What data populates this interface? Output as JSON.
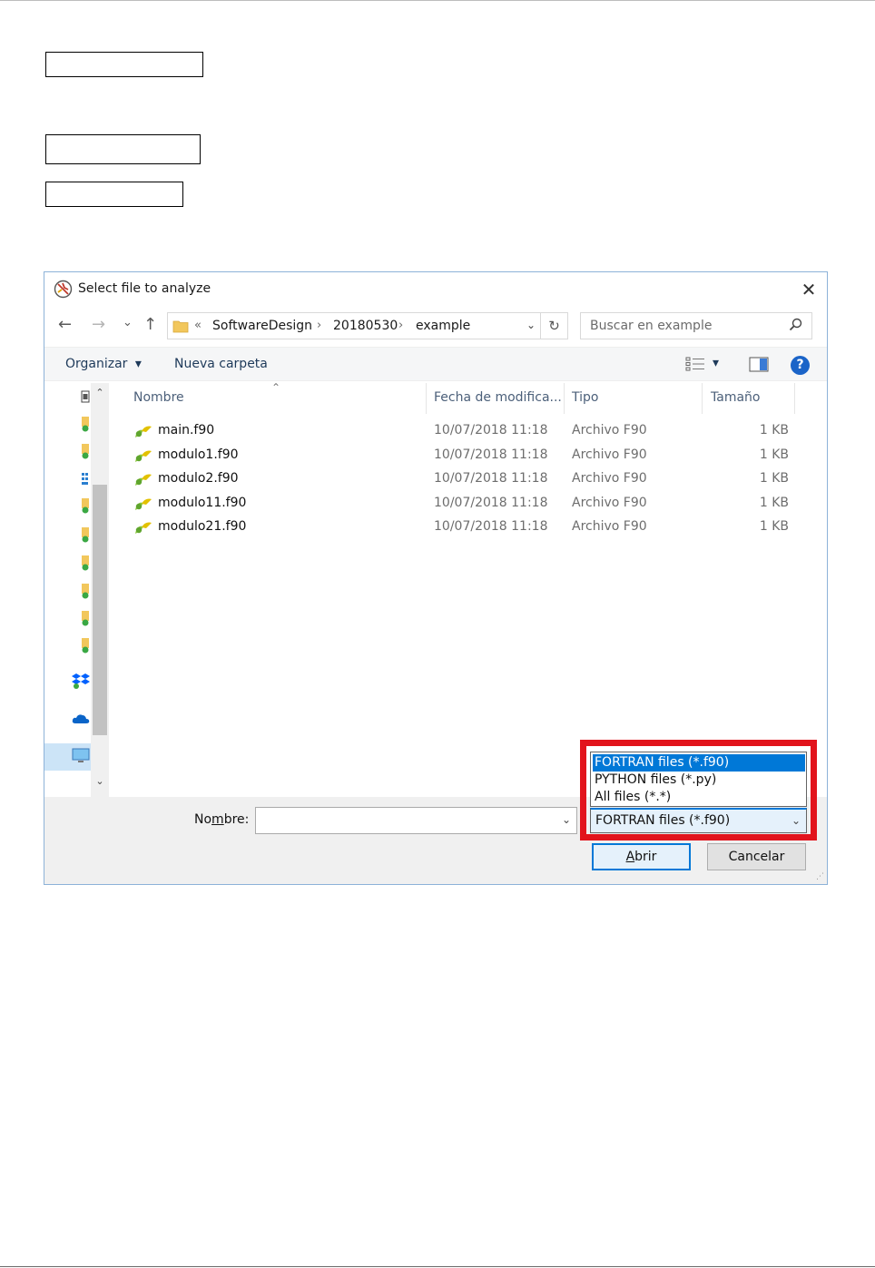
{
  "dialog": {
    "title": "Select file to analyze",
    "close_glyph": "✕"
  },
  "nav": {
    "back_glyph": "←",
    "forward_glyph": "→",
    "recent_glyph": "⌄",
    "up_glyph": "↑",
    "breadcrumb_prefix": "«",
    "breadcrumbs": [
      "SoftwareDesign",
      "20180530",
      "example"
    ],
    "crumb_separator": "›",
    "dropdown_glyph": "⌄",
    "refresh_glyph": "↻",
    "search_placeholder": "Buscar en example"
  },
  "toolbar": {
    "organize_label": "Organizar",
    "new_folder_label": "Nueva carpeta",
    "caret_glyph": "▾",
    "help_glyph": "?"
  },
  "columns": {
    "name": "Nombre",
    "date": "Fecha de modifica...",
    "type": "Tipo",
    "size": "Tamaño",
    "sort_glyph": "⌃"
  },
  "files": [
    {
      "name": "main.f90",
      "date": "10/07/2018 11:18",
      "type": "Archivo F90",
      "size": "1 KB"
    },
    {
      "name": "modulo1.f90",
      "date": "10/07/2018 11:18",
      "type": "Archivo F90",
      "size": "1 KB"
    },
    {
      "name": "modulo2.f90",
      "date": "10/07/2018 11:18",
      "type": "Archivo F90",
      "size": "1 KB"
    },
    {
      "name": "modulo11.f90",
      "date": "10/07/2018 11:18",
      "type": "Archivo F90",
      "size": "1 KB"
    },
    {
      "name": "modulo21.f90",
      "date": "10/07/2018 11:18",
      "type": "Archivo F90",
      "size": "1 KB"
    }
  ],
  "navpane": {
    "scroll_up_glyph": "⌃",
    "scroll_down_glyph": "⌄"
  },
  "bottom": {
    "name_label_pre": "No",
    "name_label_mnemonic": "m",
    "name_label_post": "bre:",
    "name_value": "",
    "name_dropdown_glyph": "⌄",
    "open_mnemonic": "A",
    "open_rest": "brir",
    "cancel_label": "Cancelar",
    "grip_glyph": "⋰"
  },
  "filter": {
    "options": [
      "FORTRAN files (*.f90)",
      "PYTHON files (*.py)",
      "All files (*.*)"
    ],
    "selected_index": 0,
    "current": "FORTRAN files (*.f90)",
    "dropdown_glyph": "⌄"
  },
  "colors": {
    "highlight": "#e2141c",
    "selection": "#0078d7",
    "help_icon": "#1a64c8"
  }
}
